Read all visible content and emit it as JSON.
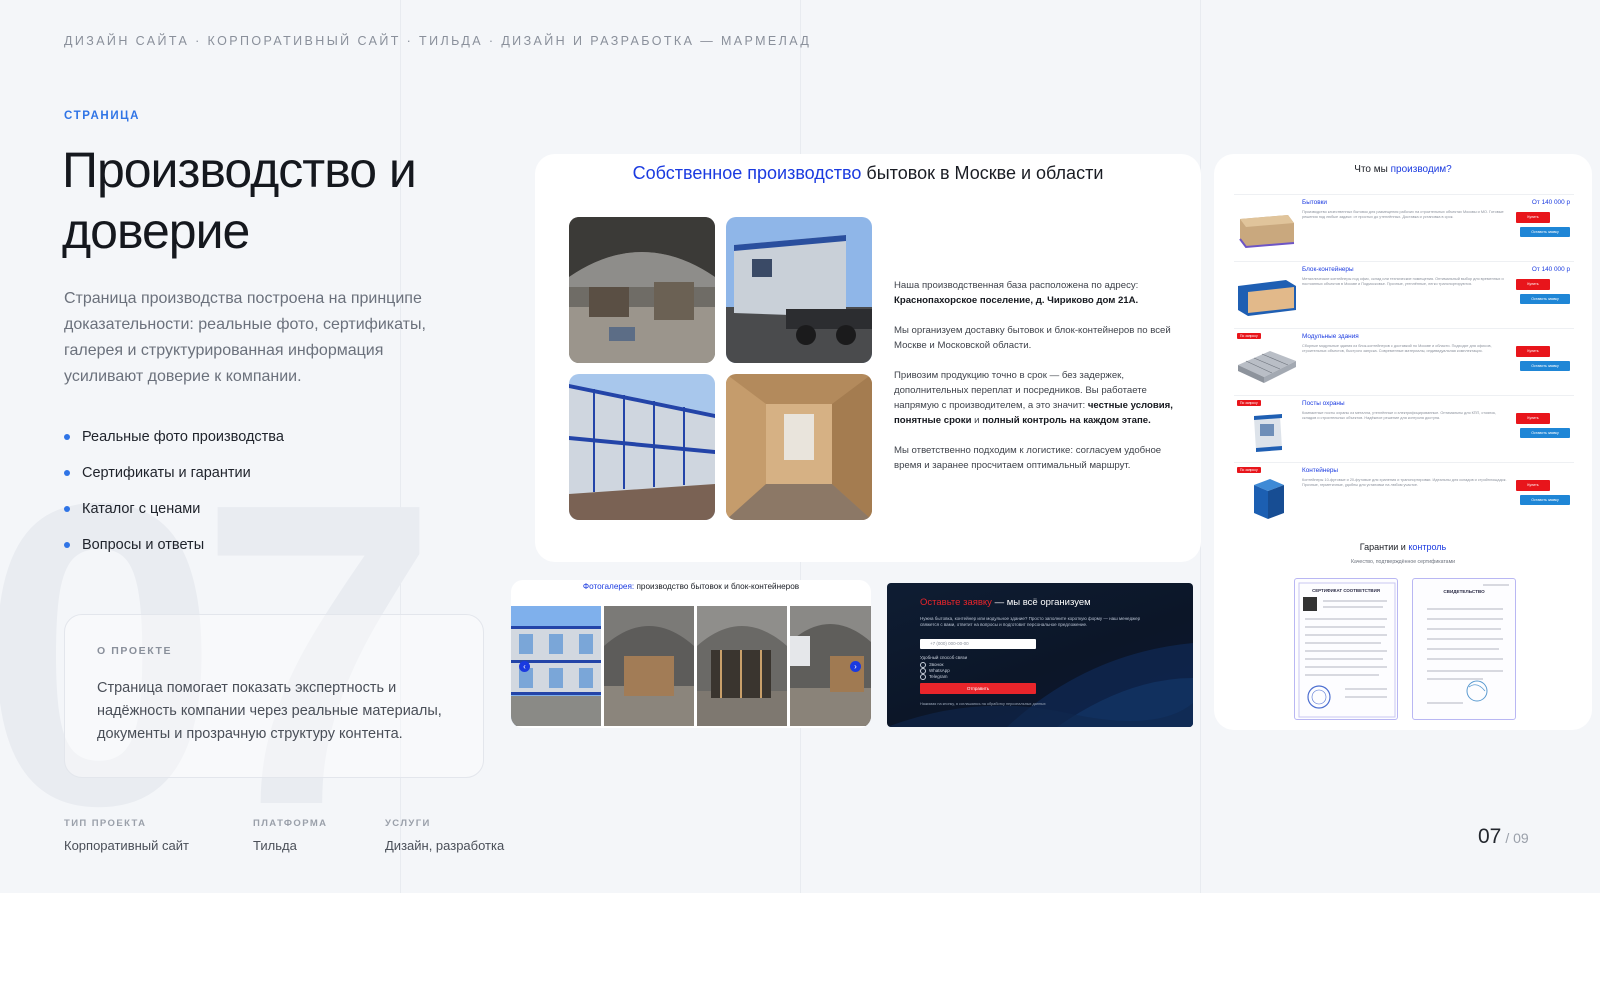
{
  "header": {
    "breadcrumb": "ДИЗАЙН САЙТА · КОРПОРАТИВНЫЙ САЙТ · ТИЛЬДА · ДИЗАЙН И РАЗРАБОТКА — МАРМЕЛАД"
  },
  "intro": {
    "kicker": "СТРАНИЦА",
    "title": "Производство и доверие",
    "lead": "Страница производства построена на принципе доказательности: реальные фото, сертификаты, галерея и структурированная информация усиливают доверие к компании.",
    "bullets": [
      "Реальные фото производства",
      "Сертификаты и гарантии",
      "Каталог с ценами",
      "Вопросы и ответы"
    ]
  },
  "background_number": "07",
  "about": {
    "label": "О ПРОЕКТЕ",
    "text": "Страница помогает показать экспертность и надёжность компании через реальные материалы, документы и прозрачную структуру контента."
  },
  "meta": [
    {
      "label": "ТИП ПРОЕКТА",
      "value": "Корпоративный сайт"
    },
    {
      "label": "ПЛАТФОРМА",
      "value": "Тильда"
    },
    {
      "label": "УСЛУГИ",
      "value": "Дизайн, разработка"
    }
  ],
  "pager": {
    "current": "07",
    "total": "/ 09"
  },
  "production_card": {
    "title_accent": "Собственное производство",
    "title_rest": " бытовок в Москве и области",
    "p1": "Наша производственная база расположена по адресу:",
    "p1_bold": "Краснопахорское поселение, д. Чириково дом 21А.",
    "p2": "Мы организуем доставку бытовок и блок-контейнеров по всей Москве и Московской области.",
    "p3": "Привозим продукцию точно в срок — без задержек, дополнительных переплат и посредников. Вы работаете напрямую с производителем, а это значит: ",
    "p3_b1": "честные условия, понятные сроки",
    "p3_mid": " и ",
    "p3_b2": "полный контроль на каждом этапе.",
    "p4": "Мы ответственно подходим к логистике: согласуем удобное время и заранее просчитаем оптимальный маршрут."
  },
  "gallery": {
    "title_accent": "Фотогалерея:",
    "title_rest": " производство бытовок и блок-контейнеров"
  },
  "form": {
    "title_accent": "Оставьте заявку",
    "title_rest": " — мы всё организуем",
    "sub": "Нужна бытовка, контейнер или модульное здание? Просто заполните короткую форму — наш менеджер свяжется с вами, ответит на вопросы и подготовит персональное предложение.",
    "phone_placeholder": "+7 (000) 000-00-00",
    "contact_label": "Удобный способ связи",
    "options": [
      "Звонок",
      "WhatsApp",
      "Telegram"
    ],
    "submit": "Отправить",
    "note": "Нажимая на кнопку, я соглашаюсь на обработку персональных данных"
  },
  "catalog": {
    "title": "Что мы ",
    "title_accent": "производим?",
    "buy_label": "Купить",
    "request_label": "Оставить заявку",
    "items": [
      {
        "name": "Бытовки",
        "price": "От 140 000 р",
        "badge": "",
        "desc": "Производство качественных бытовок для размещения рабочих на строительных объектах Москвы и МО. Готовые решения под любые задачи: от простых до утеплённых. Доставка и установка в срок."
      },
      {
        "name": "Блок-контейнеры",
        "price": "От 140 000 р",
        "badge": "",
        "desc": "Металлические контейнеры под офис, склад или технические помещения. Оптимальный выбор для временных и постоянных объектов в Москве и Подмосковье. Прочные, утеплённые, легко транспортируются."
      },
      {
        "name": "Модульные здания",
        "price": "",
        "badge": "По запросу",
        "desc": "Сборные модульные здания из блок-контейнеров с доставкой по Москве и области. Подходят для офисов, строительных объектов, быстрого запуска. Современные материалы, индивидуальная комплектация."
      },
      {
        "name": "Посты охраны",
        "price": "",
        "badge": "По запросу",
        "desc": "Компактные посты охраны из металла, утеплённые и электрифицированные. Оптимальны для КПП, стоянок, складов и строительных объектов. Надёжное решение для контроля доступа."
      },
      {
        "name": "Контейнеры",
        "price": "",
        "badge": "По запросу",
        "desc": "Контейнеры 10-футовые и 20-футовые для хранения и транспортировки. Идеальны для складов и стройплощадок. Прочные, герметичные, удобны для установки на любом участке."
      }
    ],
    "guarantee_title": "Гарантии и ",
    "guarantee_accent": "контроль",
    "guarantee_sub": "Качество, подтверждённое сертификатами",
    "cert1_title": "СЕРТИФИКАТ СООТВЕТСТВИЯ",
    "cert2_title": "СВИДЕТЕЛЬСТВО"
  },
  "colors": {
    "accent": "#2f74e6",
    "brand_blue": "#1a3ae0",
    "brand_red": "#e8151b",
    "page_bg": "#f4f6f9"
  }
}
